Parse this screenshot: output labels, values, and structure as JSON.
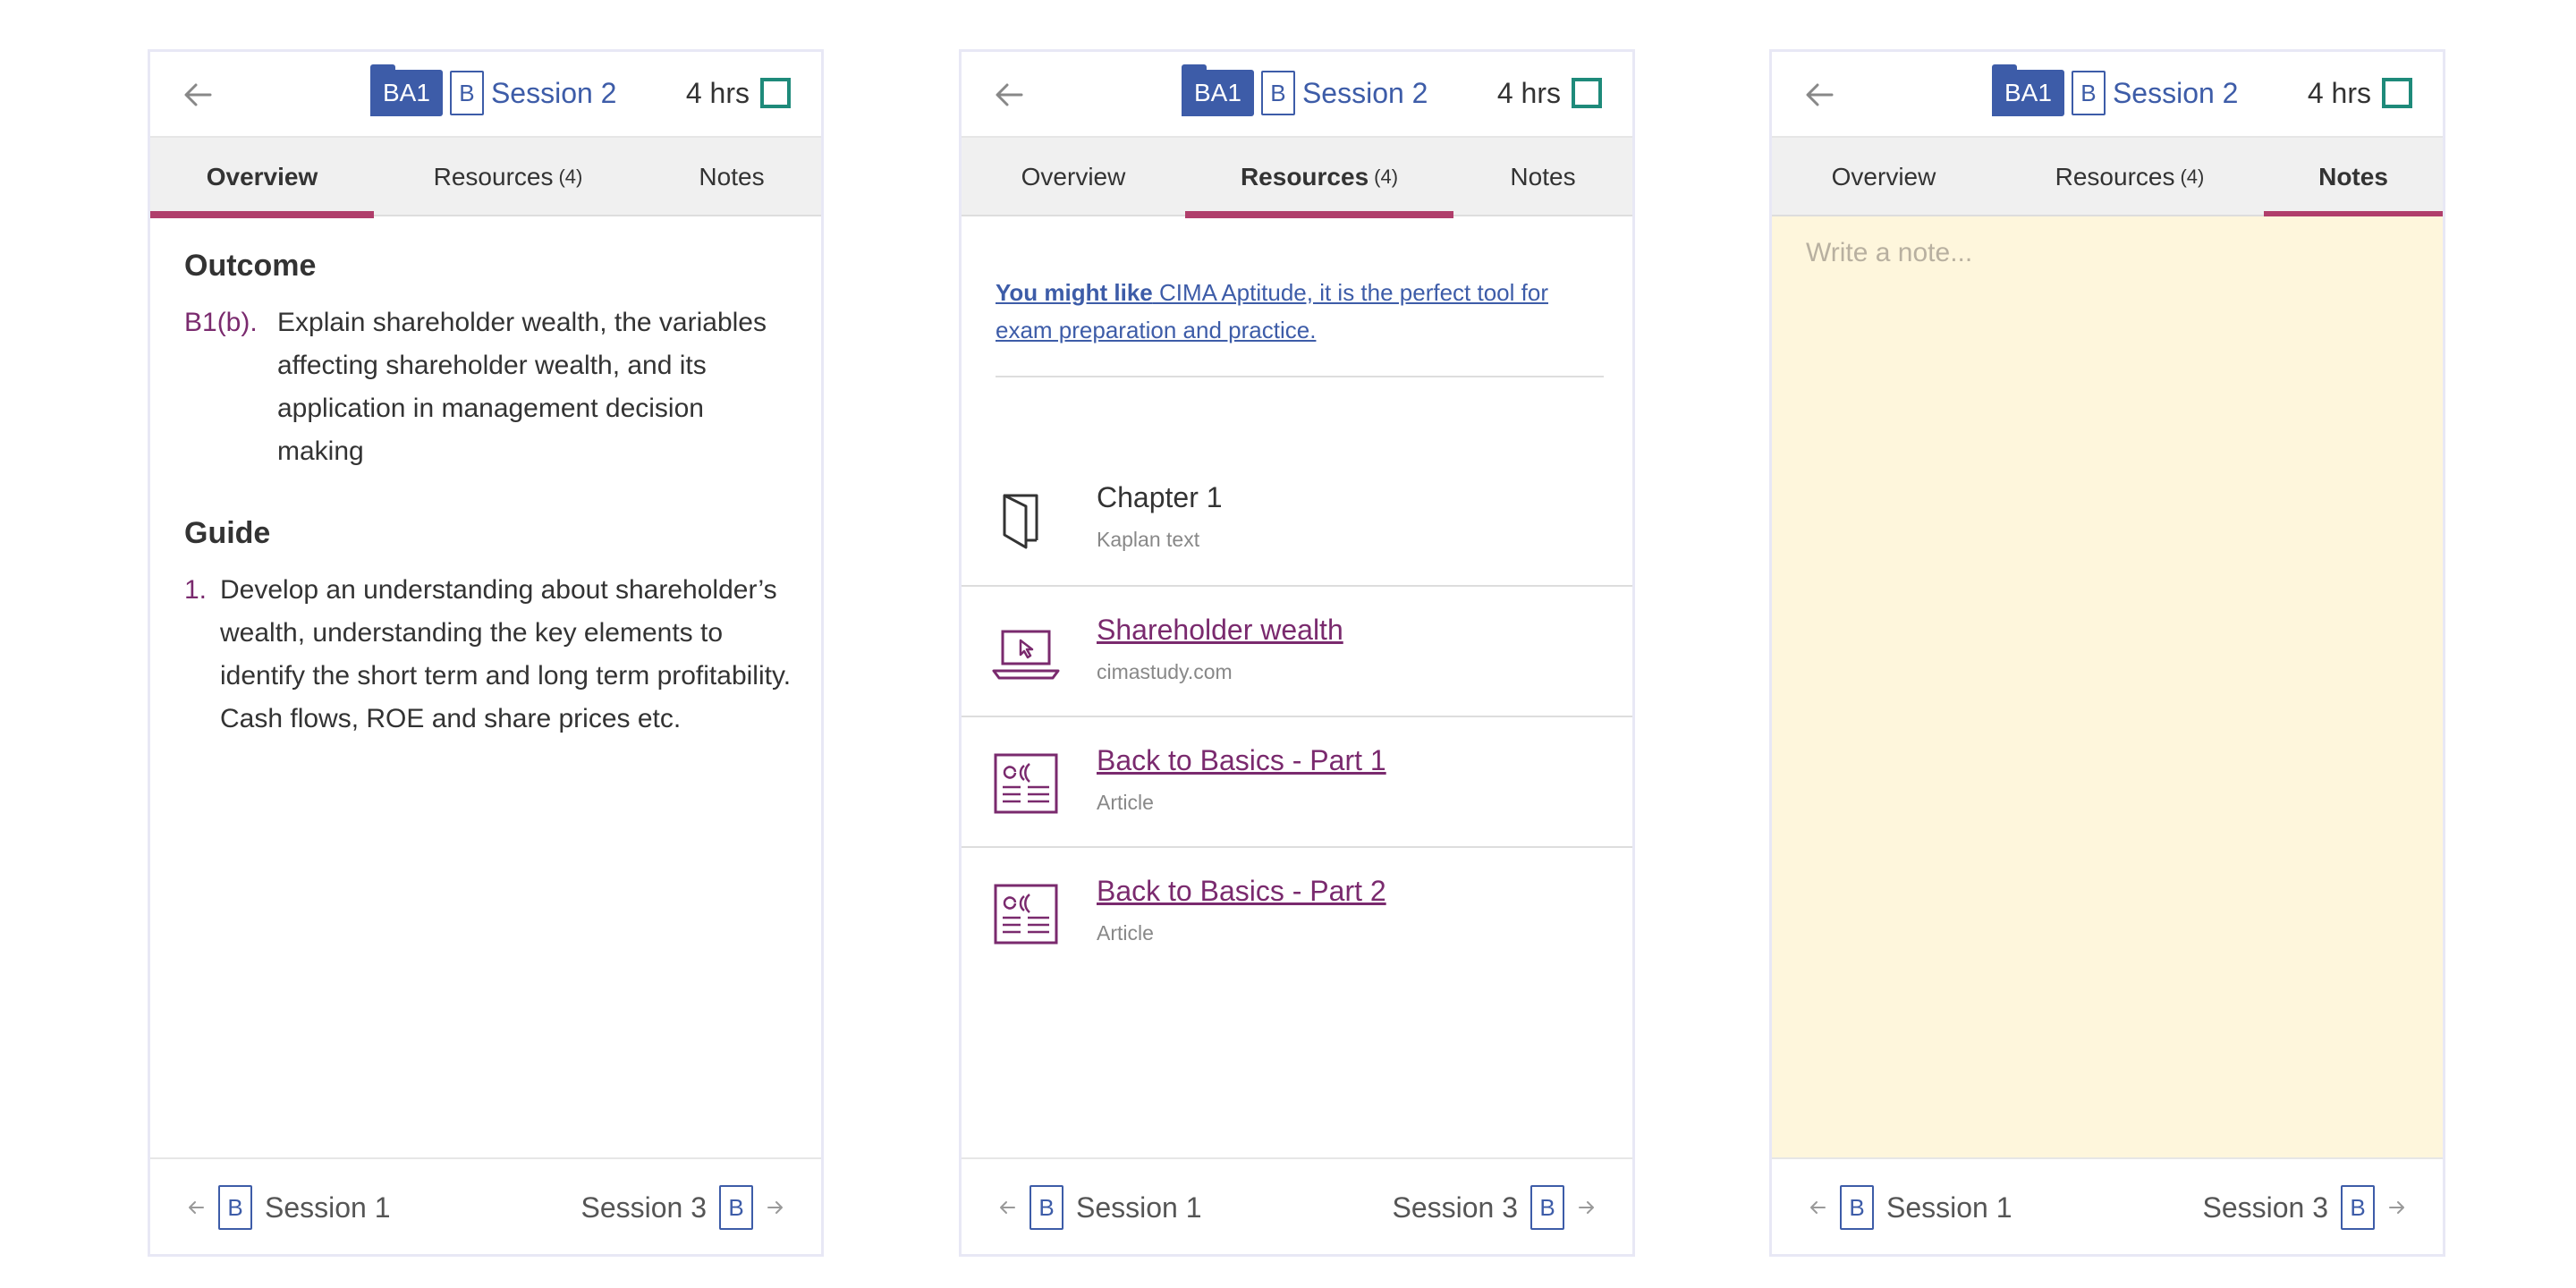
{
  "header": {
    "code": "BA1",
    "b_icon": "B",
    "session": "Session 2",
    "hours": "4 hrs"
  },
  "tabs": {
    "overview": "Overview",
    "resources": "Resources",
    "resources_count": "(4)",
    "notes": "Notes"
  },
  "footer": {
    "prev_b": "B",
    "prev_label": "Session 1",
    "next_label": "Session 3",
    "next_b": "B"
  },
  "overview": {
    "outcome_title": "Outcome",
    "outcome_code": "B1(b).",
    "outcome_text": "Explain shareholder wealth, the variables affecting shareholder wealth, and its application in management decision making",
    "guide_title": "Guide",
    "guide_num": "1.",
    "guide_text": "Develop an understanding about shareholder’s wealth, understanding the key elements to identify the short term and long term profitability. Cash flows, ROE and share prices etc."
  },
  "resources": {
    "promo_bold": "You might like",
    "promo_text": " CIMA Aptitude, it is the perfect tool for exam preparation and practice.",
    "items": [
      {
        "title": "Chapter 1",
        "sub": "Kaplan text",
        "icon": "book-icon"
      },
      {
        "title": "Shareholder wealth",
        "sub": "cimastudy.com",
        "icon": "laptop-cursor-icon"
      },
      {
        "title": "Back to Basics - Part 1",
        "sub": "Article",
        "icon": "article-icon"
      },
      {
        "title": "Back to Basics - Part 2",
        "sub": "Article",
        "icon": "article-icon"
      }
    ]
  },
  "notes": {
    "placeholder": "Write a note..."
  },
  "colors": {
    "accent_blue": "#3d5ca8",
    "accent_purple": "#7a2a6e",
    "tab_indicator": "#b03e6b",
    "checkbox_teal": "#1e8a7a",
    "notes_bg": "#fef6dc"
  }
}
